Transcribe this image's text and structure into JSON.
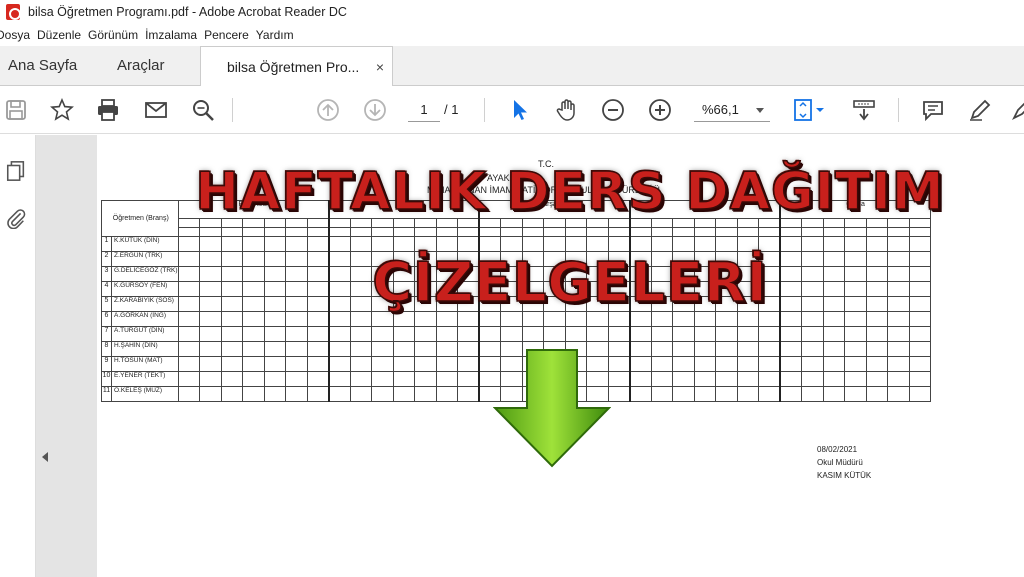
{
  "window": {
    "title": "bilsa Öğretmen Programı.pdf - Adobe Acrobat Reader DC"
  },
  "menu": [
    "Dosya",
    "Düzenle",
    "Görünüm",
    "İmzalama",
    "Pencere",
    "Yardım"
  ],
  "tabs": {
    "home": "Ana Sayfa",
    "tools": "Araçlar",
    "document": "bilsa Öğretmen Pro...",
    "close_glyph": "×"
  },
  "toolbar": {
    "page_current": "1",
    "page_total": "/ 1",
    "zoom": "%66,1",
    "icons": [
      "save-icon",
      "star-icon",
      "print-icon",
      "mail-icon",
      "zoom-search-icon",
      "page-up-icon",
      "page-down-icon",
      "select-cursor-icon",
      "hand-icon",
      "zoom-out-icon",
      "zoom-in-icon",
      "fit-page-icon",
      "scroll-mode-icon",
      "comment-icon",
      "pen-icon",
      "highlight-icon"
    ],
    "accent": "#1473e6"
  },
  "sidebar": {
    "icons": [
      "pages-icon",
      "attachment-icon"
    ]
  },
  "document": {
    "header_lines": [
      "T.C.",
      "AYAKKAMI...",
      "MİMAR SİNAN İMAM HATİP ORTAOKULU MÜDÜRLÜĞÜ"
    ],
    "teacher_header": "Öğretmen (Branş)",
    "days": [
      "Pazartesi",
      "Salı",
      "Çarşamba",
      "Perşembe",
      "Cuma"
    ],
    "teachers": [
      {
        "no": "1",
        "name": "K.KÜTÜK (DİN)"
      },
      {
        "no": "2",
        "name": "Z.ERGÜN (TRK)"
      },
      {
        "no": "3",
        "name": "G.DELİCEGÖZ (TRK)"
      },
      {
        "no": "4",
        "name": "K.GÜRSOY (FEN)"
      },
      {
        "no": "5",
        "name": "Z.KARABIYIK (SOS)"
      },
      {
        "no": "6",
        "name": "A.GÖRKAN (İNG)"
      },
      {
        "no": "7",
        "name": "A.TURGUT (DİN)"
      },
      {
        "no": "8",
        "name": "H.ŞAHİN (DİN)"
      },
      {
        "no": "9",
        "name": "H.TOSUN (MAT)"
      },
      {
        "no": "10",
        "name": "E.YENER (TEKT)"
      },
      {
        "no": "11",
        "name": "O.KELEŞ (MÜZ)"
      }
    ],
    "date": "08/02/2021",
    "signer_title": "Okul Müdürü",
    "signer_name": "KASIM KÜTÜK"
  },
  "overlay": {
    "line1": "HAFTALIK DERS DAĞITIM",
    "line2": "ÇİZELGELERİ",
    "title_color": "#c8201c",
    "arrow_color": "#6fbf1e"
  }
}
